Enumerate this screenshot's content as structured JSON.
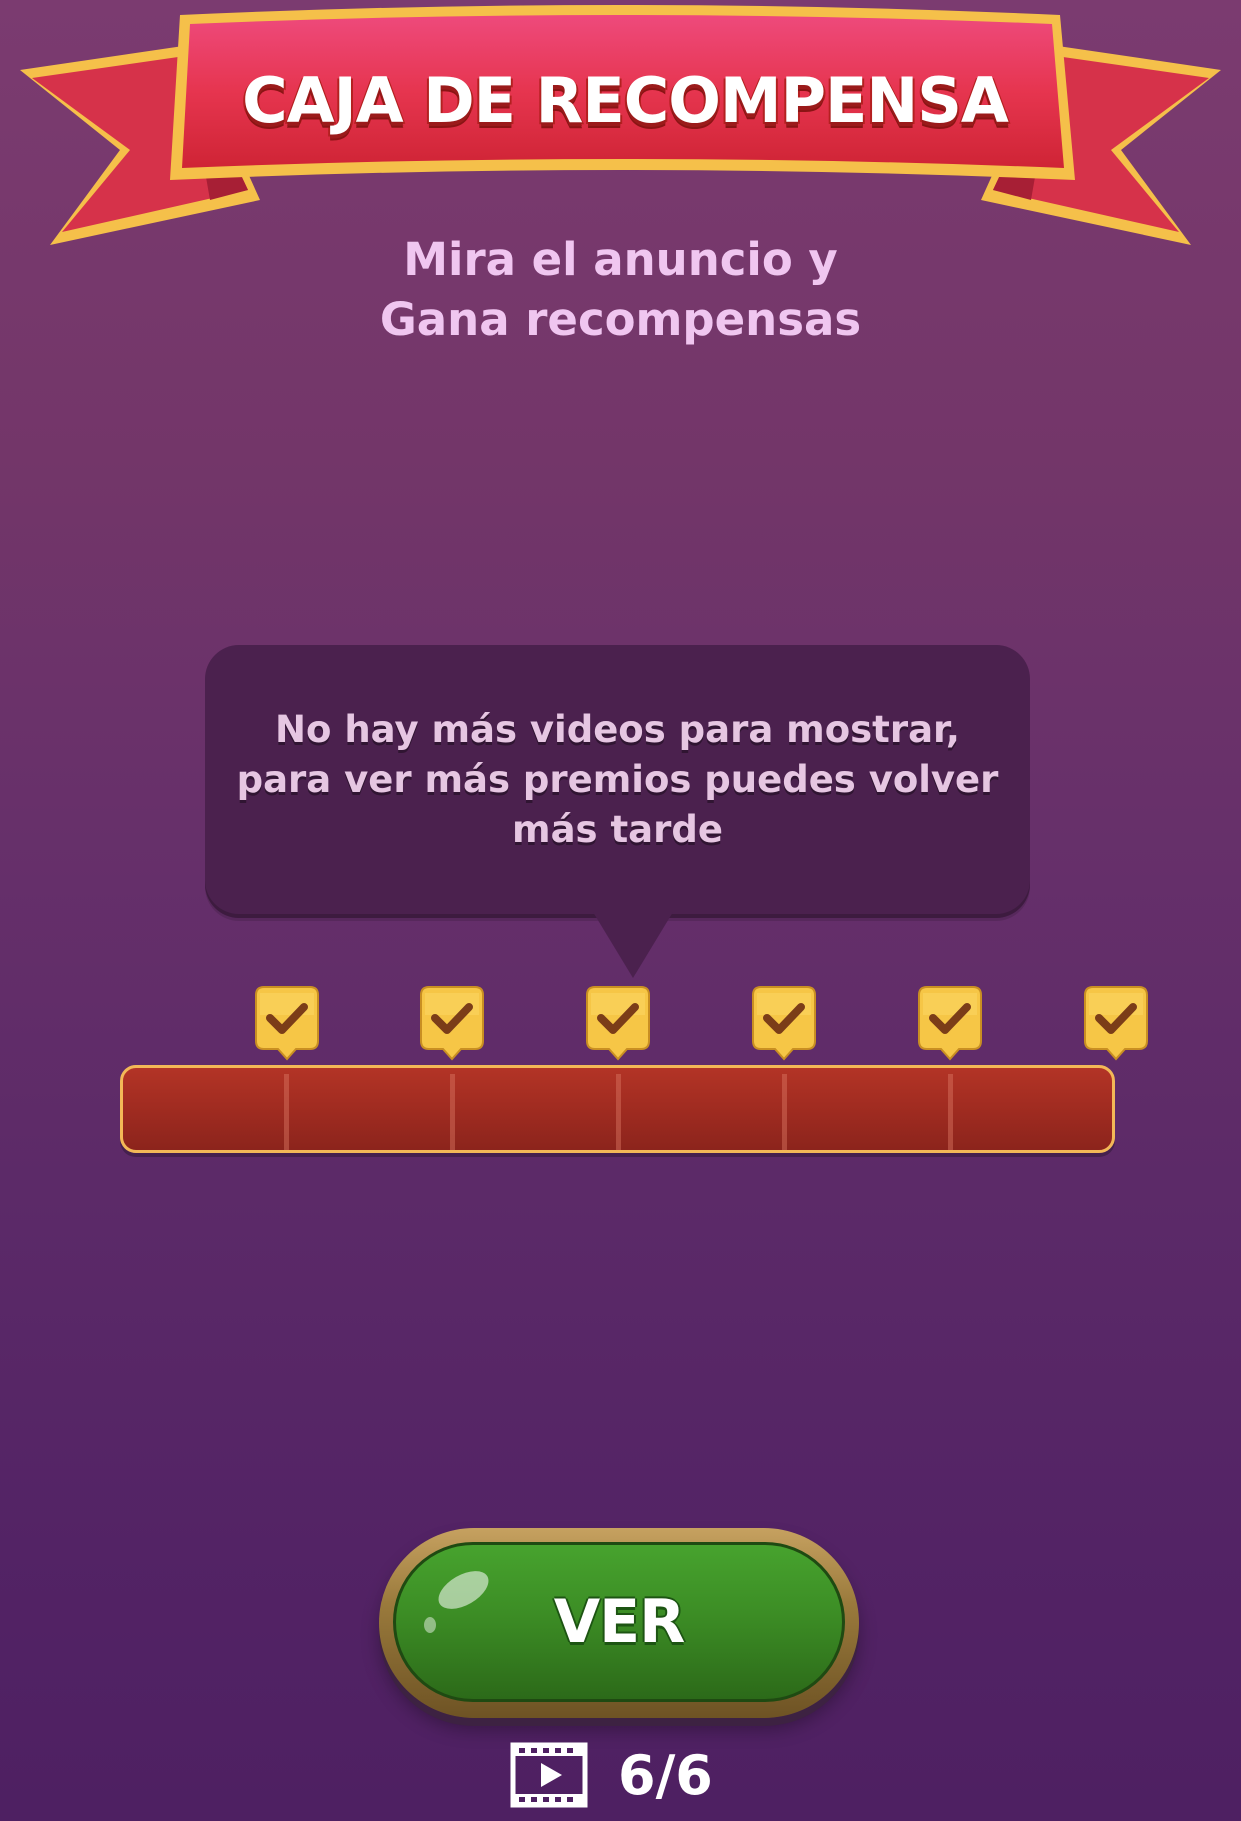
{
  "header": {
    "title": "CAJA DE RECOMPENSA"
  },
  "subtitle": {
    "line1": "Mira el anuncio y",
    "line2": "Gana recompensas"
  },
  "tooltip": {
    "line1": "No hay más videos para mostrar,",
    "line2": "para ver más premios puedes volver",
    "line3": "más tarde"
  },
  "progress": {
    "completed": 6,
    "total": 6,
    "checkpoints": [
      {
        "status": "completed",
        "icon": "check-icon"
      },
      {
        "status": "completed",
        "icon": "check-icon"
      },
      {
        "status": "completed",
        "icon": "check-icon"
      },
      {
        "status": "completed",
        "icon": "check-icon"
      },
      {
        "status": "completed",
        "icon": "check-icon"
      },
      {
        "status": "completed",
        "icon": "check-icon"
      }
    ]
  },
  "button": {
    "label": "VER"
  },
  "counter": {
    "icon": "video-film-icon",
    "text": "6/6"
  },
  "colors": {
    "background_top": "#7b3b70",
    "background_bottom": "#4e2062",
    "ribbon": "#e8334f",
    "ribbon_trim": "#f5c04a",
    "tooltip": "#4b214e",
    "checkpoint_badge": "#f6c646",
    "progress_bar": "#a22c21",
    "button_green": "#3c8d25",
    "button_rim": "#9a7a3c"
  }
}
